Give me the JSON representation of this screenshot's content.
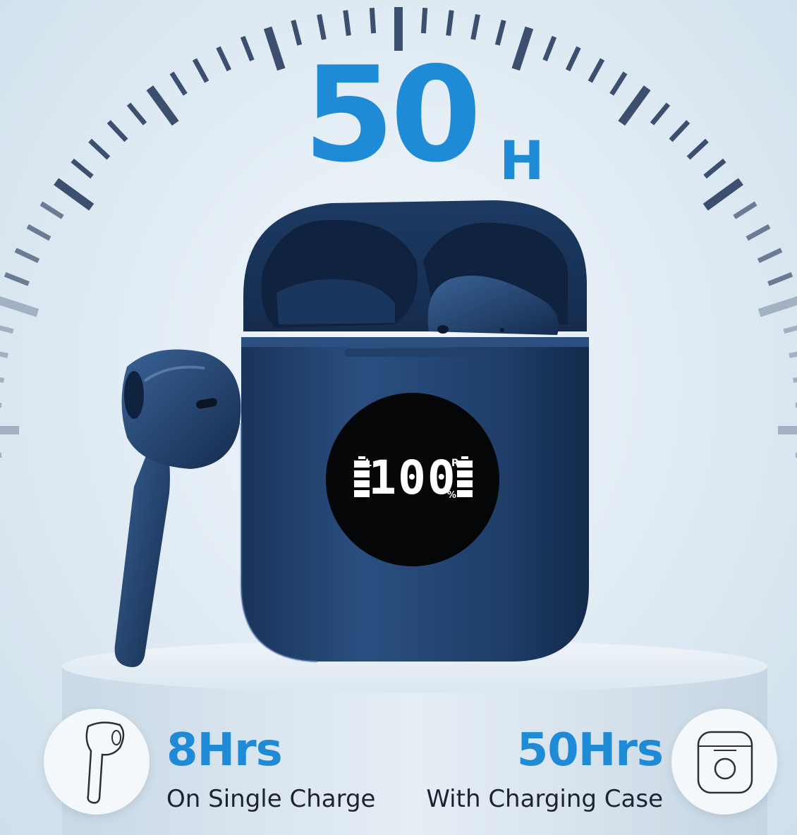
{
  "headline": {
    "value": "50",
    "unit": "H"
  },
  "display": {
    "reading": "100",
    "left_mark": "L",
    "right_mark": "R",
    "percent_sign": "%"
  },
  "stats": [
    {
      "value": "8Hrs",
      "caption": "On Single Charge",
      "icon": "earbud-outline-icon"
    },
    {
      "value": "50Hrs",
      "caption": "With Charging Case",
      "icon": "charging-case-outline-icon"
    }
  ],
  "colors": {
    "accent": "#1f8ad6",
    "product": "#1c3a66",
    "ticks": "#3c4f6e",
    "caption": "#1d2330"
  }
}
